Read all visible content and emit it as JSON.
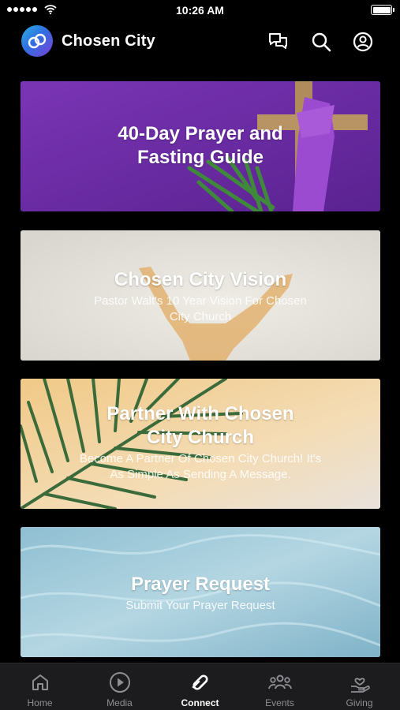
{
  "status_bar": {
    "time": "10:26 AM"
  },
  "header": {
    "title": "Chosen City"
  },
  "cards": [
    {
      "title_line1": "40-Day Prayer and",
      "title_line2": "Fasting Guide",
      "subtitle_line1": "",
      "subtitle_line2": ""
    },
    {
      "title_line1": "Chosen City Vision",
      "title_line2": "",
      "subtitle_line1": "Pastor Walt's 10 Year Vision For Chosen",
      "subtitle_line2": "City Church"
    },
    {
      "title_line1": "Partner With Chosen",
      "title_line2": "City Church",
      "subtitle_line1": "Become A Partner Of Chosen City Church! It's",
      "subtitle_line2": "As Simple As Sending A Message."
    },
    {
      "title_line1": "Prayer Request",
      "title_line2": "",
      "subtitle_line1": "Submit Your Prayer Request",
      "subtitle_line2": ""
    }
  ],
  "tabs": [
    {
      "label": "Home",
      "icon": "home-icon"
    },
    {
      "label": "Media",
      "icon": "play-icon"
    },
    {
      "label": "Connect",
      "icon": "connect-icon"
    },
    {
      "label": "Events",
      "icon": "people-icon"
    },
    {
      "label": "Giving",
      "icon": "giving-icon"
    }
  ],
  "active_tab": "Connect",
  "colors": {
    "background": "#000000",
    "tabbar": "#1c1c1e",
    "card1": "#6b2ba3",
    "logo_start": "#2bb0e6",
    "logo_end": "#7b3fd8"
  }
}
